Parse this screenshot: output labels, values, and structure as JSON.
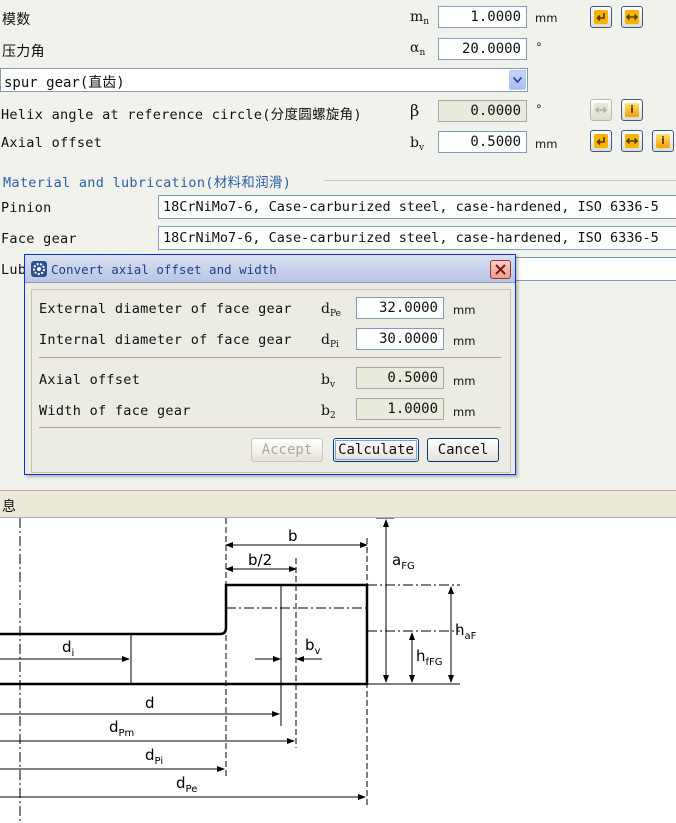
{
  "rows": {
    "module": {
      "label": "模数",
      "sym": "m",
      "sub": "n",
      "value": "1.0000",
      "unit": "mm"
    },
    "pressure": {
      "label": "压力角",
      "sym": "α",
      "sub": "n",
      "value": "20.0000",
      "unit": "°"
    },
    "gear_type": {
      "selected": "spur gear(直齿)"
    },
    "helix": {
      "label": "Helix angle at reference circle(分度圆螺旋角)",
      "sym": "β",
      "value": "0.0000",
      "unit": "°"
    },
    "axial": {
      "label": "Axial offset",
      "sym": "b",
      "sub": "v",
      "value": "0.5000",
      "unit": "mm"
    }
  },
  "materials": {
    "section_title": "Material and lubrication(材料和润滑)",
    "pinion_label": "Pinion",
    "pinion_value": "18CrNiMo7-6, Case-carburized steel, case-hardened, ISO 6336-5",
    "face_label": "Face gear",
    "face_value": "18CrNiMo7-6, Case-carburized steel, case-hardened, ISO 6336-5",
    "lub_label": "Lubrication"
  },
  "dialog": {
    "title": "Convert axial offset and width",
    "ext_label": "External diameter of face gear",
    "ext_sym": "d",
    "ext_sub": "Pe",
    "ext_value": "32.0000",
    "ext_unit": "mm",
    "int_label": "Internal diameter of face gear",
    "int_sym": "d",
    "int_sub": "Pi",
    "int_value": "30.0000",
    "int_unit": "mm",
    "off_label": "Axial offset",
    "off_sym": "b",
    "off_sub": "v",
    "off_value": "0.5000",
    "off_unit": "mm",
    "wid_label": "Width of face gear",
    "wid_sym": "b",
    "wid_sub": "2",
    "wid_value": "1.0000",
    "wid_unit": "mm",
    "accept": "Accept",
    "calculate": "Calculate",
    "cancel": "Cancel"
  },
  "info_label": "息",
  "diagram": {
    "b": "b",
    "b2": "b/2",
    "aFG": "a",
    "aFG_sub": "FG",
    "haF": "h",
    "haF_sub": "aF",
    "hfFG": "h",
    "hfFG_sub": "fFG",
    "di": "d",
    "di_sub": "i",
    "bv": "b",
    "bv_sub": "v",
    "d": "d",
    "dPm": "d",
    "dPm_sub": "Pm",
    "dPi": "d",
    "dPi_sub": "Pi",
    "dPe": "d",
    "dPe_sub": "Pe"
  },
  "icons": {
    "arrow_left": "arrow-left-icon",
    "arrows_lr": "arrows-left-right-icon",
    "info": "info-icon",
    "close": "close-icon",
    "app": "app-icon"
  }
}
